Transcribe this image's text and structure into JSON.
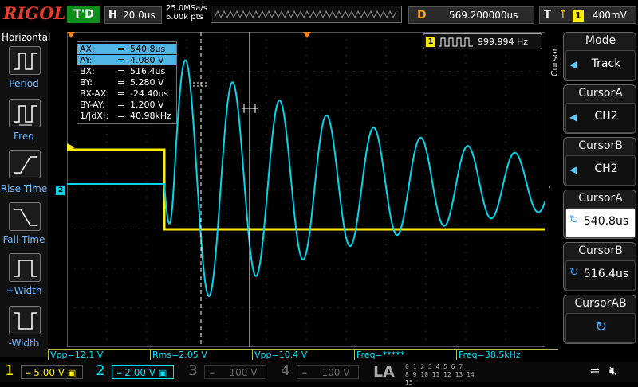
{
  "brand": "RIGOL",
  "status": "T'D",
  "horizontal": {
    "key": "H",
    "timebase": "20.0us",
    "samplerate": "25.0MSa/s",
    "points": "6.00k pts"
  },
  "delay": {
    "key": "D",
    "value": "569.200000us"
  },
  "trigger": {
    "key": "T",
    "slope": "↑",
    "channel": "1",
    "level": "400mV"
  },
  "left_toolbar": {
    "title": "Horizontal",
    "items": [
      {
        "label": "Period"
      },
      {
        "label": "Freq"
      },
      {
        "label": "Rise Time"
      },
      {
        "label": "Fall Time"
      },
      {
        "label": "+Width"
      },
      {
        "label": "-Width"
      }
    ]
  },
  "cursor_readout": {
    "rows": [
      {
        "name": "AX:",
        "eq": "=",
        "value": "540.8us"
      },
      {
        "name": "AY:",
        "eq": "=",
        "value": "4.080 V"
      },
      {
        "name": "BX:",
        "eq": "=",
        "value": "516.4us"
      },
      {
        "name": "BY:",
        "eq": "=",
        "value": "5.280 V"
      },
      {
        "name": "BX-AX:",
        "eq": "=",
        "value": "-24.40us"
      },
      {
        "name": "BY-AY:",
        "eq": "=",
        "value": "1.200 V"
      },
      {
        "name": "1/|dX|:",
        "eq": "=",
        "value": "40.98kHz"
      }
    ]
  },
  "frequency_counter": {
    "channel": "1",
    "value": "999.994 Hz"
  },
  "right_menu": {
    "title": "Cursor",
    "items": [
      {
        "title": "Mode",
        "value": "Track"
      },
      {
        "title": "CursorA",
        "value": "CH2"
      },
      {
        "title": "CursorB",
        "value": "CH2"
      },
      {
        "title": "CursorA",
        "value": "540.8us"
      },
      {
        "title": "CursorB",
        "value": "516.4us"
      },
      {
        "title": "CursorAB",
        "value": ""
      }
    ]
  },
  "measurements": [
    "Vpp=12.1 V",
    "Rms=2.05 V",
    "Vpp=10.4 V",
    "Freq=*****",
    "Freq=38.5kHz"
  ],
  "channels": [
    {
      "num": "1",
      "scale": "5.00 V",
      "color": "#ffee00"
    },
    {
      "num": "2",
      "scale": "2.00 V",
      "color": "#00e5ff"
    },
    {
      "num": "3",
      "scale": "100 V",
      "color": "#666666"
    },
    {
      "num": "4",
      "scale": "100 V",
      "color": "#666666"
    }
  ],
  "la_label": "LA",
  "la_digits": [
    "0 1 2 3  4 5 6 7",
    "8 9 10 11  12 13 14 15"
  ],
  "colors": {
    "ch1": "#ffee00",
    "ch2": "#00e5ff",
    "grid": "#3a3a3a",
    "cursor": "#ffffff"
  }
}
